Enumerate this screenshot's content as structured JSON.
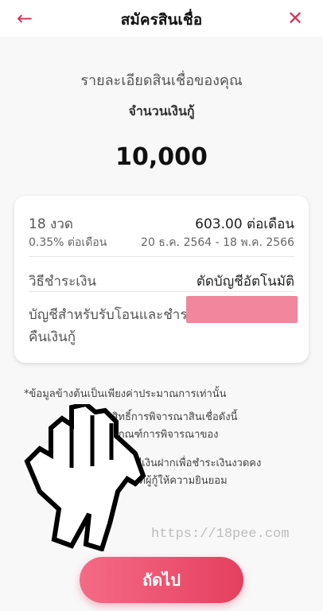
{
  "header": {
    "title": "สมัครสินเชื่อ",
    "back_icon": "arrow-left-icon",
    "close_icon": "close-icon",
    "back_glyph": "←",
    "close_glyph": "✕",
    "accent_color": "#d6345a"
  },
  "summary": {
    "subtitle": "รายละเอียดสินเชื่อของคุณ",
    "amount_label": "จำนวนเงินกู้",
    "amount": "10,000"
  },
  "details": {
    "term": "18 งวด",
    "rate": "0.35% ต่อเดือน",
    "monthly_payment": "603.00 ต่อเดือน",
    "date_range": "20 ธ.ค. 2564 - 18 พ.ค. 2566",
    "payment_method_label": "วิธีชำระเงิน",
    "payment_method_value": "ตัดบัญชีอัตโนมัติ",
    "account_label": "บัญชีสำหรับรับโอนและชำระคืนเงินกู้",
    "account_value_color": "#f2869c"
  },
  "note": "*ข้อมูลข้างต้นเป็นเพียงค่าประมาณการเท่านั้น",
  "consent": {
    "line1": "สงวนสิทธิ์การพิจารณาสินเชื่อดังนี้",
    "line2": "ตามเกณฑ์การพิจารณาของ",
    "line3": "บัญชีเงินฝากเพื่อชำระเงินงวดคง",
    "line4": "ตามที่ผู้กู้ให้ความยินยอม"
  },
  "watermark": "https://18pee.com",
  "next_button": {
    "label": "ถัดไป",
    "gradient_start": "#f56a86",
    "gradient_end": "#e4405f"
  },
  "pointer_icon": "hand-pointer-icon"
}
